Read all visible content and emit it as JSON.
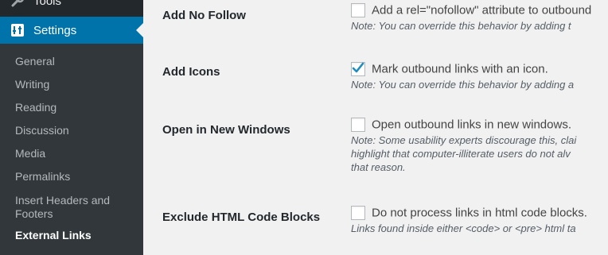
{
  "sidebar": {
    "tools_label": "Tools",
    "settings_label": "Settings",
    "items": [
      {
        "label": "General"
      },
      {
        "label": "Writing"
      },
      {
        "label": "Reading"
      },
      {
        "label": "Discussion"
      },
      {
        "label": "Media"
      },
      {
        "label": "Permalinks"
      },
      {
        "label": "Insert Headers and Footers"
      },
      {
        "label": "External Links"
      }
    ]
  },
  "settings": [
    {
      "label": "Add No Follow",
      "checked": false,
      "option_text": "Add a rel=\"nofollow\" attribute to outbound",
      "note": "Note: You can override this behavior by adding t"
    },
    {
      "label": "Add Icons",
      "checked": true,
      "option_text": "Mark outbound links with an icon.",
      "note": "Note: You can override this behavior by adding a"
    },
    {
      "label": "Open in New Windows",
      "checked": false,
      "option_text": "Open outbound links in new windows.",
      "note_lines": [
        "Note: Some usability experts discourage this, clai",
        "highlight that computer-illiterate users do not alv",
        "that reason."
      ]
    },
    {
      "label": "Exclude HTML Code Blocks",
      "checked": false,
      "option_text": "Do not process links in html code blocks.",
      "note": "Links found inside either <code> or <pre> html ta"
    }
  ],
  "colors": {
    "sidebar_bg": "#23282d",
    "submenu_bg": "#32373c",
    "active_bg": "#0073aa",
    "checkmark": "#1e8cbe"
  }
}
